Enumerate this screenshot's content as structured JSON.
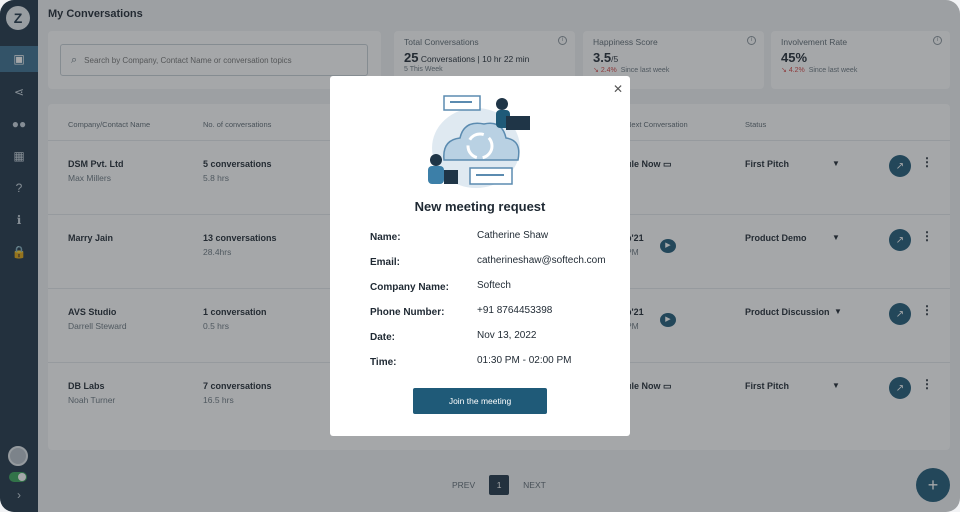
{
  "header": {
    "title": "My Conversations",
    "search_placeholder": "Search by Company, Contact Name or conversation topics"
  },
  "stats": [
    {
      "label": "Total Conversations",
      "value": "25",
      "unit": " Conversations | 10 hr 22 min",
      "sub": "5 This Week"
    },
    {
      "label": "Happiness Score",
      "value": "3.5",
      "unit": "/5",
      "change": "2.4%",
      "sub": "Since last week"
    },
    {
      "label": "Involvement Rate",
      "value": "45%",
      "unit": "",
      "change": "4.2%",
      "sub": "Since last week"
    }
  ],
  "table": {
    "headers": [
      "Company/Contact Name",
      "No. of conversations",
      "Next Conversation",
      "Status"
    ],
    "rows": [
      {
        "company": "DSM Pvt. Ltd",
        "contact": "Max Millers",
        "convs": "5 conversations",
        "hrs": "5.8 hrs",
        "next": "ule Now",
        "next_sub": "",
        "status": "First Pitch"
      },
      {
        "company": "Marry Jain",
        "contact": "",
        "convs": "13 conversations",
        "hrs": "28.4hrs",
        "next": "p'21",
        "next_sub": "PM",
        "status": "Product Demo"
      },
      {
        "company": "AVS Studio",
        "contact": "Darrell Steward",
        "convs": "1 conversation",
        "hrs": "0.5 hrs",
        "next": "p'21",
        "next_sub": "PM",
        "status": "Product Discussion"
      },
      {
        "company": "DB Labs",
        "contact": "Noah Turner",
        "convs": "7 conversations",
        "hrs": "16.5 hrs",
        "next": "ule Now",
        "next_sub": "",
        "status": "First Pitch"
      }
    ]
  },
  "pager": {
    "prev": "PREV",
    "page": "1",
    "next": "NEXT"
  },
  "modal": {
    "title": "New meeting request",
    "fields": [
      {
        "label": "Name:",
        "value": "Catherine Shaw"
      },
      {
        "label": "Email:",
        "value": "catherineshaw@softech.com"
      },
      {
        "label": "Company Name:",
        "value": "Softech"
      },
      {
        "label": "Phone Number:",
        "value": "+91 8764453398"
      },
      {
        "label": "Date:",
        "value": "Nov 13, 2022"
      },
      {
        "label": "Time:",
        "value": "01:30 PM - 02:00 PM"
      }
    ],
    "button": "Join the meeting"
  },
  "colors": {
    "sidebar": "#1f3547",
    "accent": "#1f5a78",
    "down": "#d64545"
  }
}
